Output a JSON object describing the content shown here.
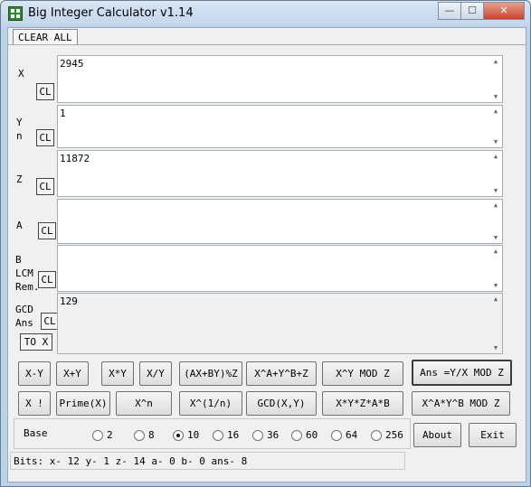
{
  "window": {
    "title": "Big Integer Calculator v1.14",
    "min_label": "—",
    "max_label": "☐",
    "close_label": "✕"
  },
  "tabs": [
    "CLEAR ALL"
  ],
  "fields": {
    "x": {
      "label": "X",
      "value": "2945",
      "cl": "CL"
    },
    "y": {
      "label": "Y\nn",
      "value": "1",
      "cl": "CL"
    },
    "z": {
      "label": "Z",
      "value": "11872",
      "cl": "CL"
    },
    "a": {
      "label": "A",
      "value": "",
      "cl": "CL"
    },
    "b": {
      "label": "B\nLCM\nRem.",
      "value": "",
      "cl": "CL"
    },
    "ans": {
      "label": "GCD\nAns",
      "value": "129",
      "cl": "CL",
      "to_x": "TO X"
    }
  },
  "buttons_row1": [
    "X-Y",
    "X+Y",
    "X*Y",
    "X/Y",
    "(AX+BY)%Z",
    "X^A+Y^B+Z",
    "X^Y MOD Z",
    "Ans =Y/X MOD Z"
  ],
  "buttons_row2": [
    "X !",
    "Prime(X)",
    "X^n",
    "X^(1/n)",
    "GCD(X,Y)",
    "X*Y*Z*A*B",
    "X^A*Y^B MOD Z"
  ],
  "base": {
    "label": "Base",
    "options": [
      "2",
      "8",
      "10",
      "16",
      "36",
      "60",
      "64",
      "256"
    ],
    "selected": "10"
  },
  "about_label": "About",
  "exit_label": "Exit",
  "status": "Bits: x- 12 y- 1 z- 14 a- 0 b- 0 ans- 8"
}
